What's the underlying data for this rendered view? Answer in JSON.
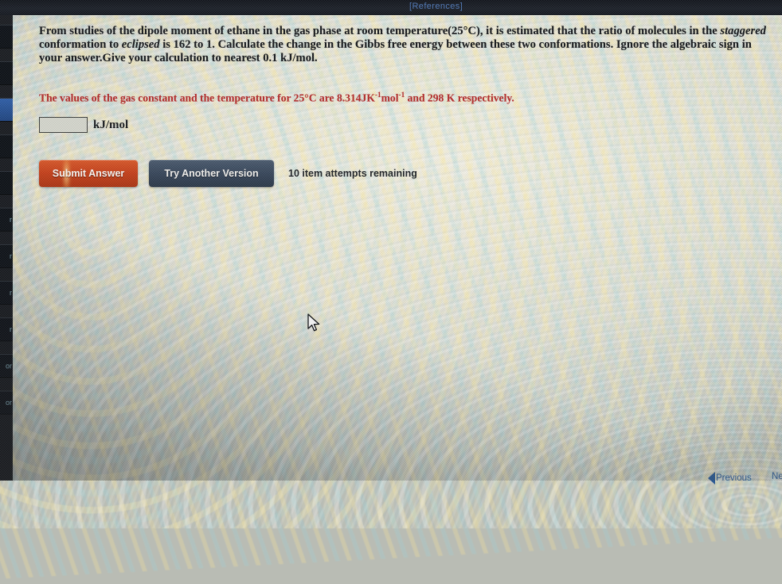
{
  "topbar": {
    "references_label": "[References]",
    "references_color": "#4f79b8",
    "bar_color": "#161a21"
  },
  "sidebar": {
    "items": [
      {
        "label": "",
        "selected": false
      },
      {
        "label": "",
        "selected": false
      },
      {
        "label": "",
        "selected": true
      },
      {
        "label": "",
        "selected": false
      },
      {
        "label": "",
        "selected": false
      },
      {
        "label": "r",
        "selected": false
      },
      {
        "label": "r",
        "selected": false
      },
      {
        "label": "r",
        "selected": false
      },
      {
        "label": "r",
        "selected": false
      },
      {
        "label": "or",
        "selected": false
      },
      {
        "label": "or",
        "selected": false
      }
    ]
  },
  "question": {
    "part1": "From studies of the dipole moment of ethane in the gas phase at room temperature(25°C), it is estimated that the ratio of molecules in the ",
    "emphasis1": "staggered",
    "part2": " conformation to ",
    "emphasis2": "eclipsed",
    "part3": " is 162 to 1. Calculate the change in the Gibbs free energy between these two conformations. Ignore the algebraic sign in your answer.Give your calculation to nearest 0.1 kJ/mol."
  },
  "hint": {
    "text_before": "The values of the gas constant and the temperature for 25°C are 8.314JK",
    "sup1": "-1",
    "text_mid": "mol",
    "sup2": "-1",
    "text_after": " and 298 K respectively.",
    "color": "#b52a2a"
  },
  "answer": {
    "value": "",
    "placeholder": "",
    "unit_label": "kJ/mol"
  },
  "actions": {
    "submit_label": "Submit Answer",
    "submit_color": "#c5401a",
    "try_another_label": "Try Another Version",
    "try_another_color": "#37465a",
    "attempts_text": "10 item attempts remaining"
  },
  "footer": {
    "previous_label": "Previous",
    "next_label": "Ne",
    "link_color": "#2d5b95"
  }
}
